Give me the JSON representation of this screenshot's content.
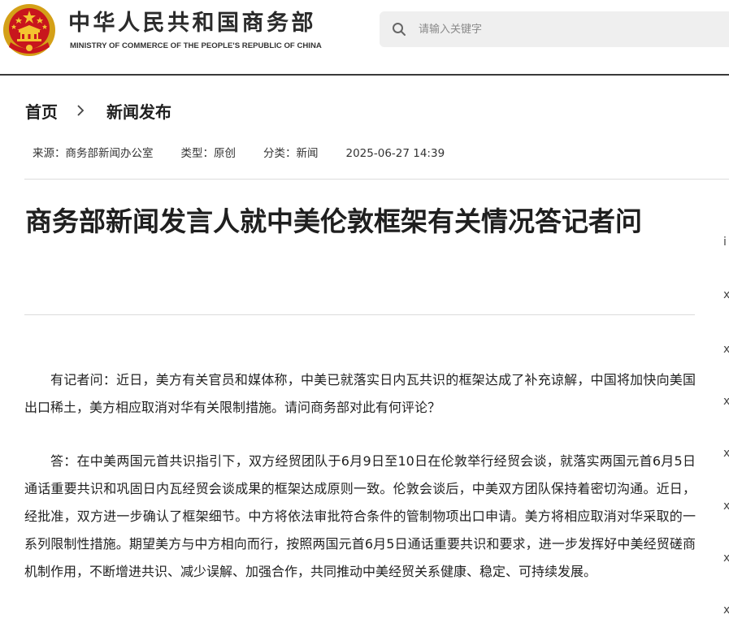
{
  "header": {
    "org_name_cn": "中华人民共和国商务部",
    "org_name_en": "MINISTRY OF COMMERCE OF THE PEOPLE'S REPUBLIC OF CHINA",
    "emblem_icon": "national-emblem-icon",
    "search": {
      "placeholder": "请输入关键字",
      "value": "",
      "icon": "search-icon"
    }
  },
  "breadcrumb": {
    "home": "首页",
    "separator_icon": "chevron-right-icon",
    "section": "新闻发布"
  },
  "meta": {
    "source": "来源：商务部新闻办公室",
    "type": "类型：原创",
    "category": "分类：新闻",
    "datetime": "2025-06-27 14:39"
  },
  "article": {
    "title": "商务部新闻发言人就中美伦敦框架有关情况答记者问",
    "paragraphs": [
      "有记者问：近日，美方有关官员和媒体称，中美已就落实日内瓦共识的框架达成了补充谅解，中国将加快向美国出口稀土，美方相应取消对华有关限制措施。请问商务部对此有何评论？",
      "答：在中美两国元首共识指引下，双方经贸团队于6月9日至10日在伦敦举行经贸会谈，就落实两国元首6月5日通话重要共识和巩固日内瓦经贸会谈成果的框架达成原则一致。伦敦会谈后，中美双方团队保持着密切沟通。近日，经批准，双方进一步确认了框架细节。中方将依法审批符合条件的管制物项出口申请。美方将相应取消对华采取的一系列限制性措施。期望美方与中方相向而行，按照两国元首6月5日通话重要共识和要求，进一步发挥好中美经贸磋商机制作用，不断增进共识、减少误解、加强合作，共同推动中美经贸关系健康、稳定、可持续发展。"
    ]
  },
  "sidebar": {
    "cut_glyphs": [
      "i",
      "x",
      "x",
      "x",
      "x",
      "x",
      "x",
      "x"
    ]
  },
  "colors": {
    "emblem_red": "#c8161d",
    "emblem_gold": "#f4c430",
    "header_rule": "#3a3a3a",
    "search_bg": "#efefef",
    "divider": "#dcdcdc"
  }
}
